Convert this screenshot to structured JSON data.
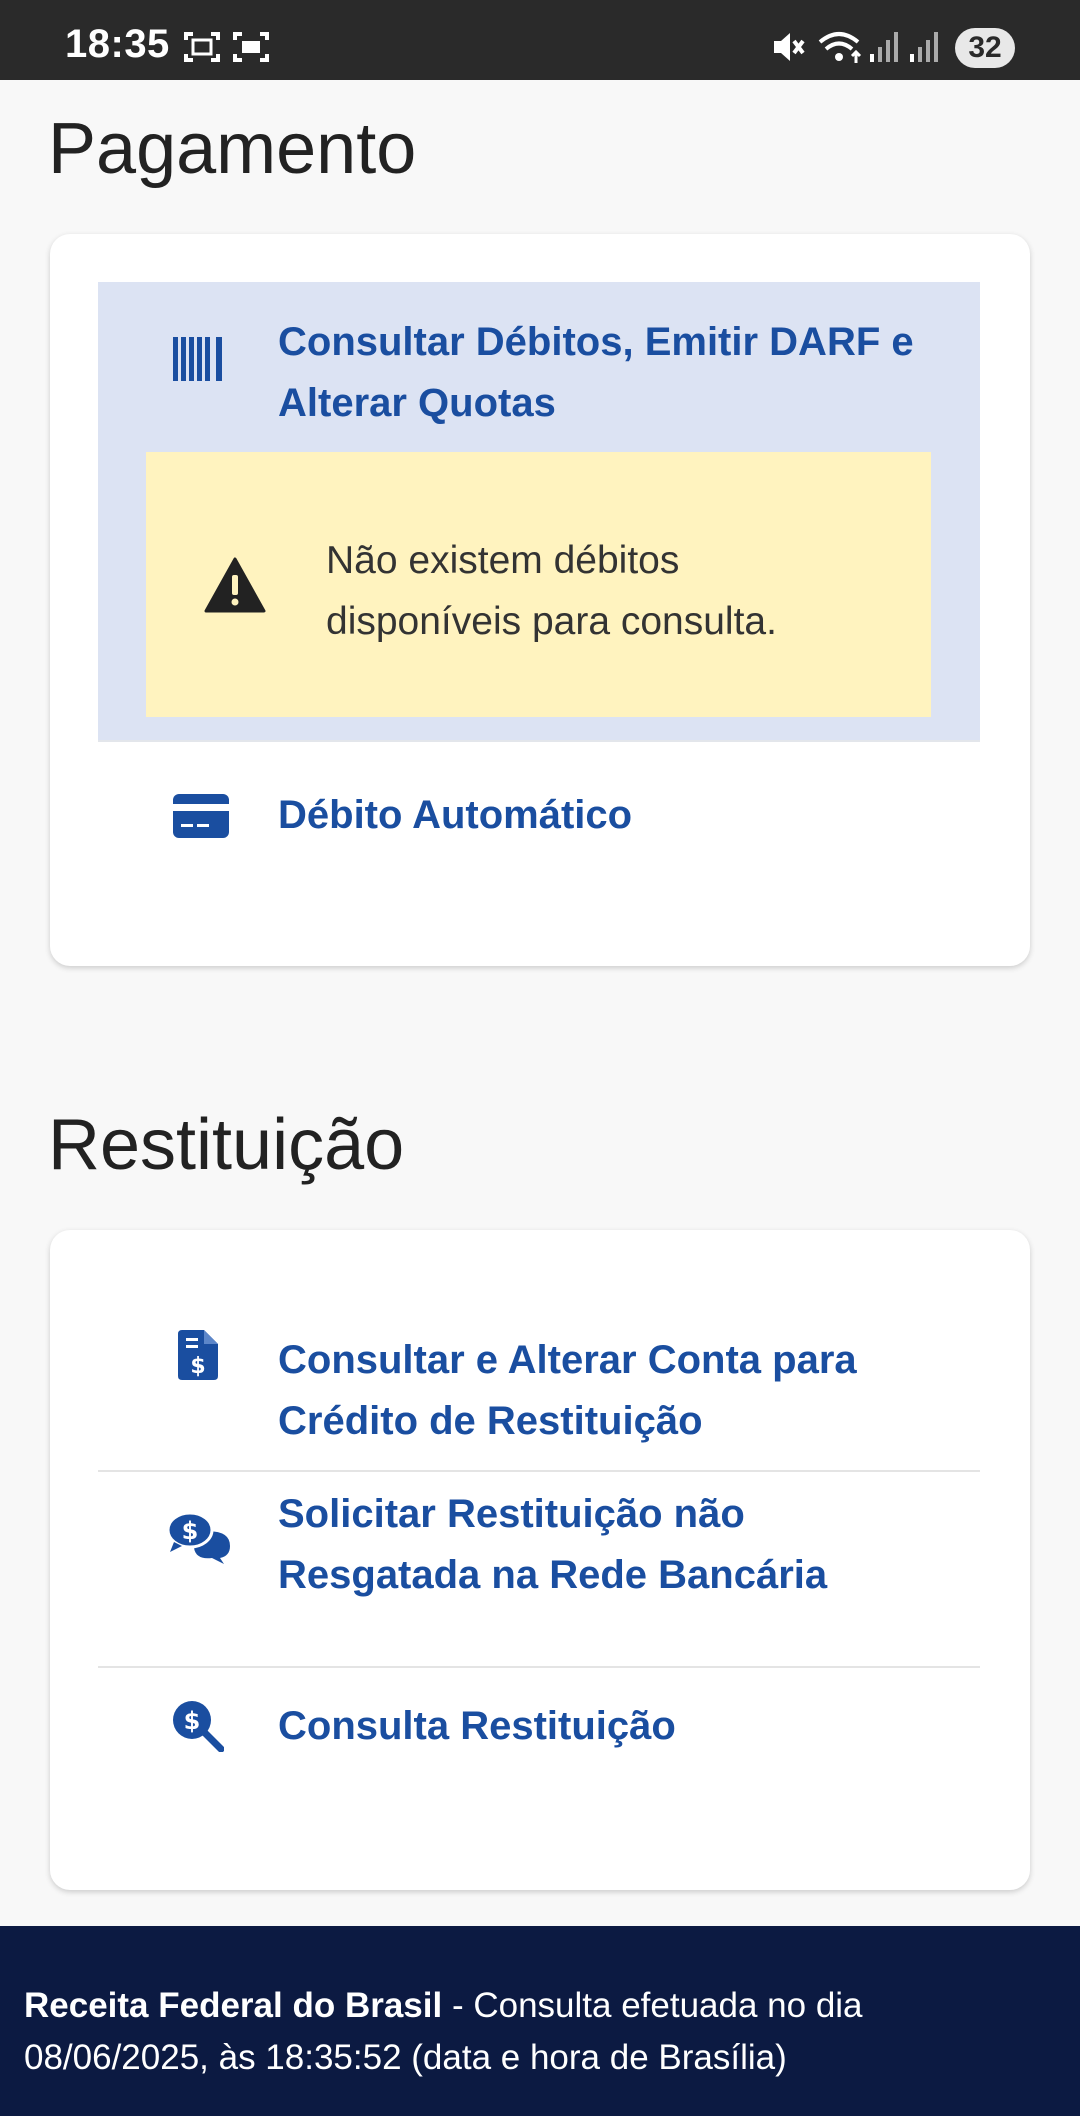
{
  "status_bar": {
    "time": "18:35",
    "battery": "32",
    "icons": [
      "screenshot-icon",
      "screen-record-icon",
      "mute-icon",
      "wifi-icon",
      "signal-icon",
      "signal-icon"
    ]
  },
  "payment": {
    "title": "Pagamento",
    "items": [
      {
        "icon": "barcode-icon",
        "label_line1": "Consultar Débitos, Emitir DARF e",
        "label_line2": "Alterar Quotas",
        "warning": {
          "icon": "warning-icon",
          "line1": "Não existem débitos",
          "line2": "disponíveis para consulta."
        }
      },
      {
        "icon": "credit-card-icon",
        "label": "Débito Automático"
      }
    ]
  },
  "refund": {
    "title": "Restituição",
    "items": [
      {
        "icon": "document-dollar-icon",
        "label_line1": "Consultar e Alterar Conta para",
        "label_line2": "Crédito de Restituição"
      },
      {
        "icon": "chat-dollar-icon",
        "label_line1": "Solicitar Restituição não",
        "label_line2": "Resgatada na Rede Bancária"
      },
      {
        "icon": "search-dollar-icon",
        "label": "Consulta Restituição"
      }
    ]
  },
  "footer": {
    "org": "Receita Federal do Brasil",
    "text": " - Consulta efetuada no dia 08/06/2025, às 18:35:52 (data e hora de Brasília)"
  },
  "colors": {
    "link": "#1a4ea0",
    "highlight": "#dce3f3",
    "warning": "#fff3bf",
    "footer": "#0c1a42",
    "status_bar": "#2a2a2a"
  }
}
